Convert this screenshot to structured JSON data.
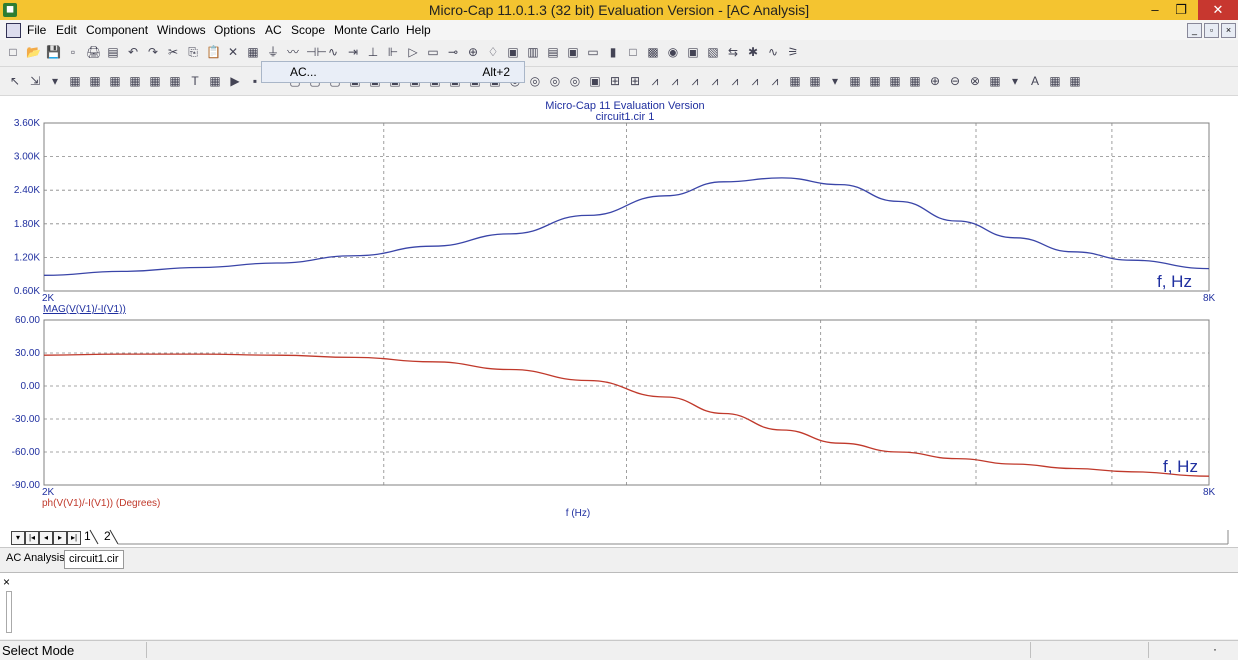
{
  "window": {
    "title": "Micro-Cap 11.0.1.3 (32 bit) Evaluation Version - [AC Analysis]",
    "minimize": "–",
    "restore": "❐",
    "close": "✕"
  },
  "menu": [
    "File",
    "Edit",
    "Component",
    "Windows",
    "Options",
    "AC",
    "Scope",
    "Monte Carlo",
    "Help"
  ],
  "dropdown": {
    "label": "AC...",
    "shortcut": "Alt+2"
  },
  "toolbar_glyphs_row1": [
    "□",
    "📂",
    "💾",
    "▫",
    "🖨",
    "▤",
    "↶",
    "↷",
    "✂",
    "⎘",
    "📋",
    "✕",
    "▦",
    "⏚",
    "〰",
    "⊣⊢",
    "∿",
    "⇥",
    "⊥",
    "⊩",
    "▷",
    "▭",
    "⊸",
    "⊕",
    "♢",
    "▣",
    "▥",
    "▤",
    "▣",
    "▭",
    "▮",
    "□",
    "▩",
    "◉",
    "▣",
    "▧",
    "⇆",
    "✱",
    "∿",
    "⚞"
  ],
  "toolbar_glyphs_row2": [
    "↖",
    "⇲",
    "▾",
    "▦",
    "▦",
    "▦",
    "▦",
    "▦",
    "▦",
    "T",
    "▦",
    "▶",
    "▪",
    "▫",
    "▢",
    "▢",
    "▢",
    "▣",
    "▣",
    "▣",
    "▣",
    "▣",
    "▣",
    "▣",
    "▣",
    "◎",
    "◎",
    "◎",
    "◎",
    "▣",
    "⊞",
    "⊞",
    "⩘",
    "⩘",
    "⩘",
    "⩘",
    "⩘",
    "⩘",
    "⩘",
    "▦",
    "▦",
    "▾",
    "▦",
    "▦",
    "▦",
    "▦",
    "⊕",
    "⊖",
    "⊗",
    "▦",
    "▾",
    "A",
    "▦",
    "▦"
  ],
  "plot": {
    "header": "Micro-Cap 11 Evaluation Version",
    "subheader": "circuit1.cir 1",
    "axis_label": "f (Hz)",
    "top_trace_label": "MAG(V(V1)/-I(V1))",
    "bottom_trace_label": "ph(V(V1)/-I(V1)) (Degrees)",
    "top_annot": "f, Hz",
    "bottom_annot": "f, Hz",
    "x_min_label": "2K",
    "x_max_label": "8K"
  },
  "chart_data": [
    {
      "type": "line",
      "title": "",
      "xlabel": "f (Hz)",
      "ylabel": "MAG(V(V1)/-I(V1))",
      "xlim": [
        2000,
        8000
      ],
      "ylim": [
        600,
        3600
      ],
      "yticks": [
        "3.60K",
        "3.00K",
        "2.40K",
        "1.80K",
        "1.20K",
        "0.60K"
      ],
      "xticks": [
        "2K",
        "8K"
      ],
      "xgrid": [
        3750,
        5000,
        6000,
        6800,
        7500
      ],
      "series": [
        {
          "name": "MAG(V(V1)/-I(V1))",
          "color": "#3a45a8",
          "x": [
            2000,
            2400,
            2800,
            3200,
            3600,
            4000,
            4400,
            4800,
            5200,
            5500,
            5800,
            6100,
            6400,
            6700,
            7000,
            7300,
            7600,
            8000
          ],
          "y": [
            880,
            950,
            1020,
            1100,
            1230,
            1400,
            1620,
            1950,
            2300,
            2550,
            2620,
            2500,
            2200,
            1850,
            1550,
            1300,
            1150,
            1000
          ]
        }
      ]
    },
    {
      "type": "line",
      "title": "",
      "xlabel": "f (Hz)",
      "ylabel": "ph(V(V1)/-I(V1)) (Degrees)",
      "xlim": [
        2000,
        8000
      ],
      "ylim": [
        -90,
        60
      ],
      "yticks": [
        "60.00",
        "30.00",
        "0.00",
        "-30.00",
        "-60.00",
        "-90.00"
      ],
      "xticks": [
        "2K",
        "8K"
      ],
      "xgrid": [
        3750,
        5000,
        6000,
        6800,
        7500
      ],
      "series": [
        {
          "name": "ph(V(V1)/-I(V1)) (Degrees)",
          "color": "#c0392b",
          "x": [
            2000,
            2400,
            2800,
            3200,
            3600,
            4000,
            4400,
            4800,
            5200,
            5500,
            5800,
            6100,
            6400,
            6700,
            7000,
            7300,
            7600,
            8000
          ],
          "y": [
            28,
            29,
            29,
            28,
            26,
            22,
            15,
            5,
            -10,
            -25,
            -40,
            -52,
            -60,
            -66,
            -71,
            -75,
            -78,
            -82
          ]
        }
      ]
    }
  ],
  "page_tabs": [
    "1",
    "2"
  ],
  "bottom_tabs": [
    "AC Analysis",
    "circuit1.cir"
  ],
  "output_close": "×",
  "status": {
    "text": "Select Mode",
    "corner": "·"
  }
}
